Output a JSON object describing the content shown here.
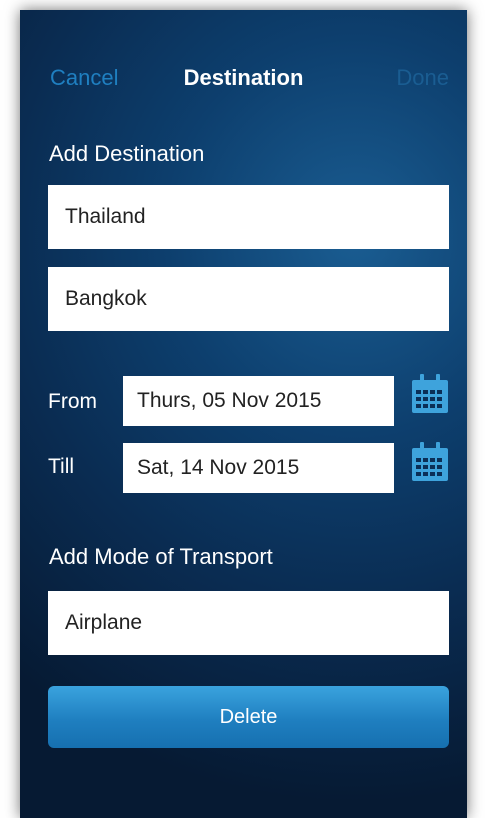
{
  "nav": {
    "cancel_label": "Cancel",
    "title": "Destination",
    "done_label": "Done"
  },
  "destination": {
    "section_label": "Add Destination",
    "country": "Thailand",
    "city": "Bangkok"
  },
  "dates": {
    "from_label": "From",
    "from_value": "Thurs, 05 Nov 2015",
    "till_label": "Till",
    "till_value": "Sat, 14 Nov 2015",
    "icon": "calendar-icon"
  },
  "transport": {
    "section_label": "Add Mode of Transport",
    "mode": "Airplane"
  },
  "actions": {
    "delete_label": "Delete"
  },
  "colors": {
    "accent": "#1f7fc0",
    "background_dark": "#0a2c52",
    "done_disabled": "#1a5d92",
    "calendar_icon": "#3ea3dc"
  }
}
